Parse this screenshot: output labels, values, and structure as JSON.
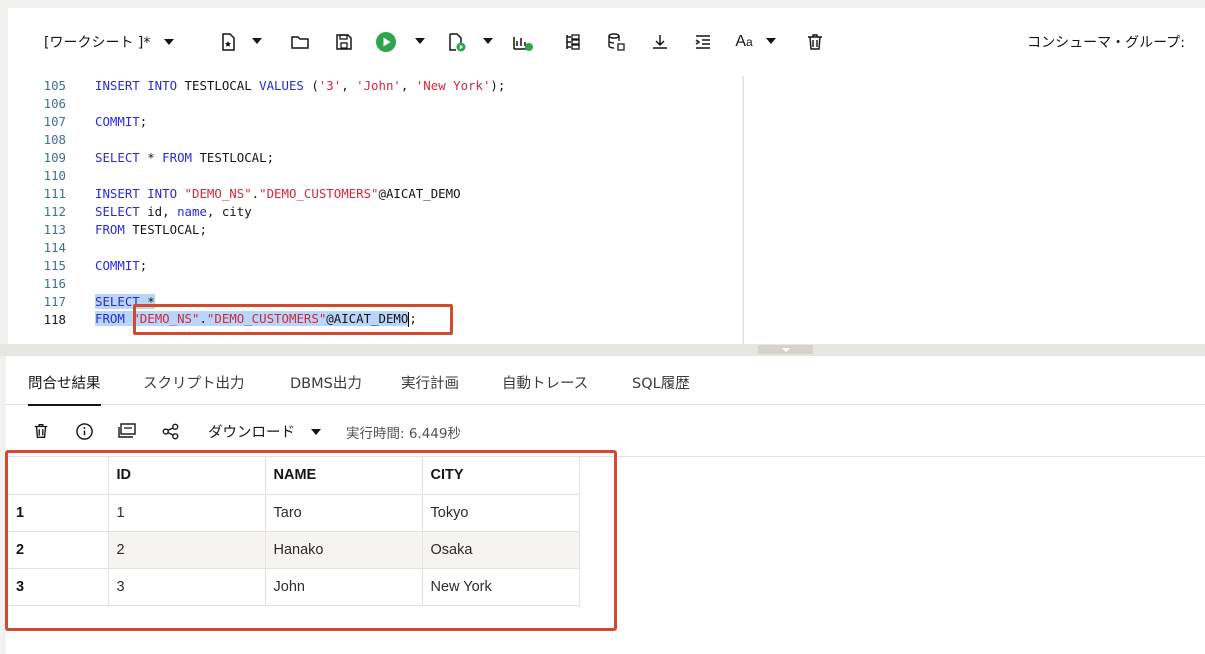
{
  "toolbar": {
    "worksheet_label": "[ワークシート ]*",
    "consumer_group_label": "コンシューマ・グループ:",
    "icons": [
      "new-file-icon",
      "open-folder-icon",
      "save-icon",
      "run-icon",
      "run-script-icon",
      "explain-plan-icon",
      "autotrace-icon",
      "database-icon",
      "download-icon",
      "format-icon",
      "font-case-icon",
      "trash-icon"
    ]
  },
  "editor": {
    "lines": [
      {
        "num": "105",
        "text": "INSERT INTO TESTLOCAL VALUES ('3', 'John', 'New York');"
      },
      {
        "num": "106",
        "text": ""
      },
      {
        "num": "107",
        "text": "COMMIT;"
      },
      {
        "num": "108",
        "text": ""
      },
      {
        "num": "109",
        "text": "SELECT * FROM TESTLOCAL;"
      },
      {
        "num": "110",
        "text": ""
      },
      {
        "num": "111",
        "text": "INSERT INTO \"DEMO_NS\".\"DEMO_CUSTOMERS\"@AICAT_DEMO"
      },
      {
        "num": "112",
        "text": "SELECT id, name, city"
      },
      {
        "num": "113",
        "text": "FROM TESTLOCAL;"
      },
      {
        "num": "114",
        "text": ""
      },
      {
        "num": "115",
        "text": "COMMIT;"
      },
      {
        "num": "116",
        "text": ""
      },
      {
        "num": "117",
        "text": "SELECT *"
      },
      {
        "num": "118",
        "text": "FROM \"DEMO_NS\".\"DEMO_CUSTOMERS\"@AICAT_DEMO;"
      }
    ]
  },
  "results": {
    "tabs": [
      "問合せ結果",
      "スクリプト出力",
      "DBMS出力",
      "実行計画",
      "自動トレース",
      "SQL履歴"
    ],
    "active_tab": "問合せ結果",
    "download_label": "ダウンロード",
    "exec_time": "実行時間: 6.449秒",
    "columns": [
      "ID",
      "NAME",
      "CITY"
    ],
    "rows": [
      {
        "n": "1",
        "id": "1",
        "name": "Taro",
        "city": "Tokyo"
      },
      {
        "n": "2",
        "id": "2",
        "name": "Hanako",
        "city": "Osaka"
      },
      {
        "n": "3",
        "id": "3",
        "name": "John",
        "city": "New York"
      }
    ]
  },
  "colors": {
    "keyword": "#2a2ad6",
    "string": "#d3283c",
    "selection": "#b9d5f7",
    "highlight_box": "#d14b2d",
    "run_button": "#2ea44f"
  }
}
